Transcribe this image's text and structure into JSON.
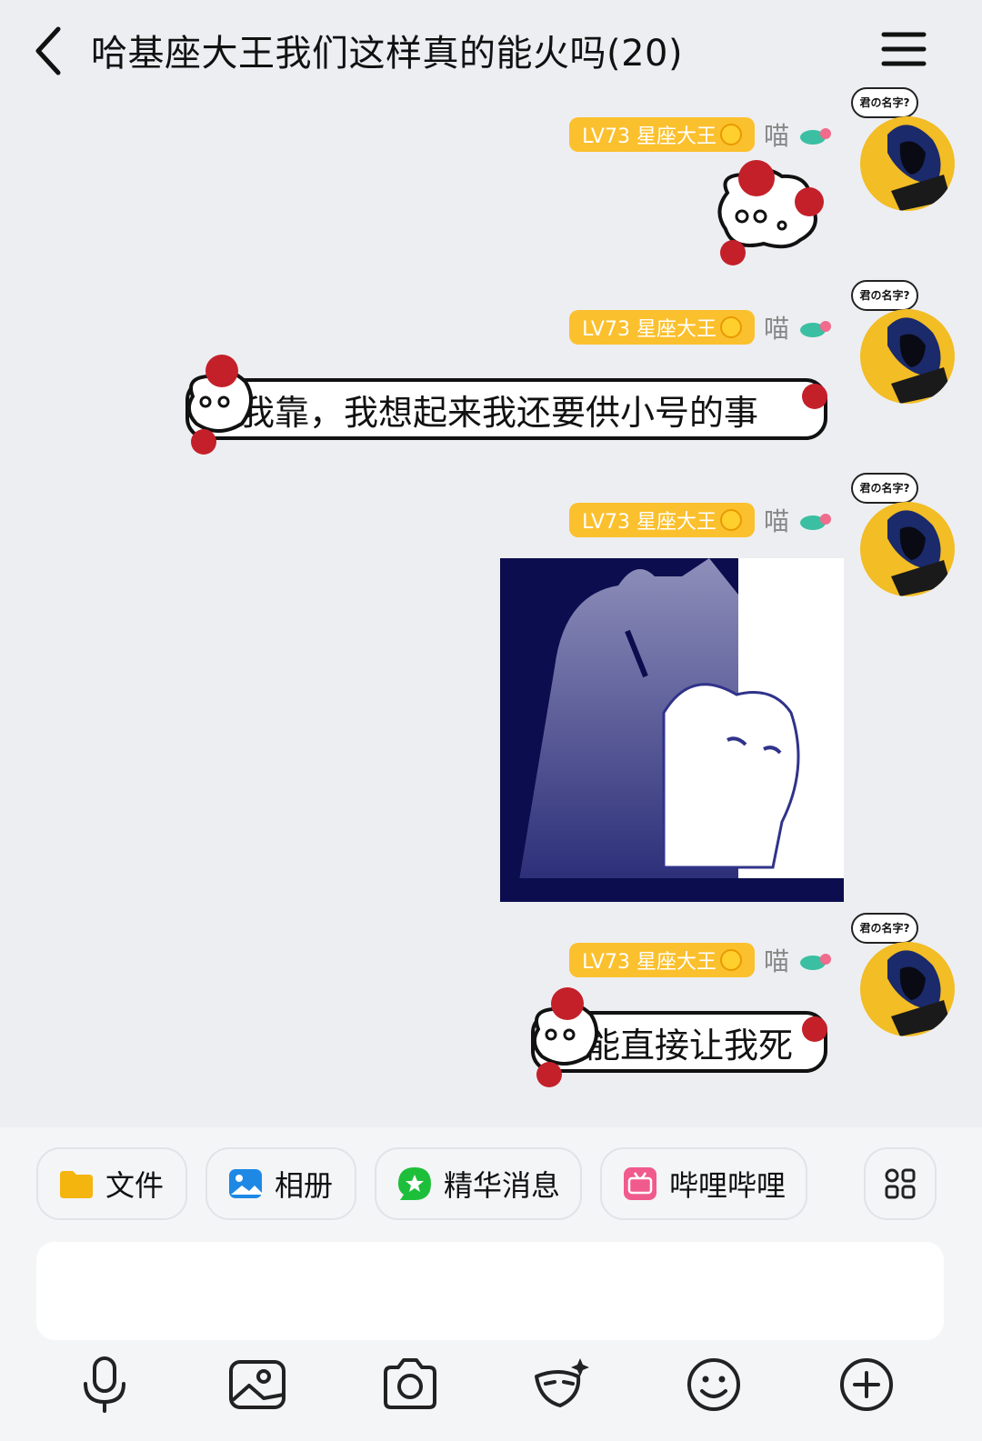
{
  "header": {
    "title": "哈基座大王我们这样真的能火吗(20)"
  },
  "messages": [
    {
      "type": "sticker",
      "level": "LV73 星座大王",
      "nickname": "喵",
      "avatar_tag": "君の名字?"
    },
    {
      "type": "text",
      "level": "LV73 星座大王",
      "nickname": "喵",
      "avatar_tag": "君の名字?",
      "text": "我靠，我想起来我还要供小号的事"
    },
    {
      "type": "image",
      "level": "LV73 星座大王",
      "nickname": "喵",
      "avatar_tag": "君の名字?"
    },
    {
      "type": "text",
      "level": "LV73 星座大王",
      "nickname": "喵",
      "avatar_tag": "君の名字?",
      "text": "能直接让我死"
    }
  ],
  "quick_bar": {
    "chips": [
      {
        "label": "文件",
        "icon": "folder-icon",
        "color": "#f5b50f"
      },
      {
        "label": "相册",
        "icon": "album-icon",
        "color": "#1e88e5"
      },
      {
        "label": "精华消息",
        "icon": "star-chat-icon",
        "color": "#1dbf3a"
      },
      {
        "label": "哔哩哔哩",
        "icon": "bilibili-icon",
        "color": "#f05a8c"
      }
    ],
    "more_icon": "apps-grid-icon"
  },
  "toolbar": {
    "icons": [
      "microphone-icon",
      "image-icon",
      "camera-icon",
      "ai-mask-icon",
      "emoji-icon",
      "plus-icon"
    ]
  },
  "colors": {
    "background": "#edeef2",
    "badge": "#fbc02d",
    "avatar": "#f2bd25"
  }
}
